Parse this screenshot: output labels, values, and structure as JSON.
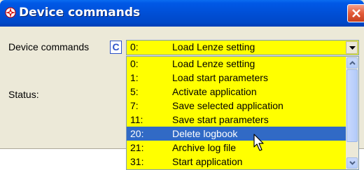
{
  "window": {
    "title": "Device commands",
    "close_icon": "close-x-icon",
    "app_icon": "compass-icon"
  },
  "form": {
    "device_commands_label": "Device commands",
    "badge": "C",
    "status_label": "Status:"
  },
  "combo": {
    "selected_num": "0:",
    "selected_text": "Load Lenze setting",
    "arrow_icon": "chevron-down-icon"
  },
  "dropdown": {
    "items": [
      {
        "num": "0:",
        "text": "Load Lenze setting"
      },
      {
        "num": "1:",
        "text": "Load start parameters"
      },
      {
        "num": "5:",
        "text": "Activate application"
      },
      {
        "num": "7:",
        "text": "Save selected application"
      },
      {
        "num": "11:",
        "text": "Save start parameters"
      },
      {
        "num": "20:",
        "text": "Delete logbook"
      },
      {
        "num": "21:",
        "text": "Archive log file"
      },
      {
        "num": "31:",
        "text": "Start application"
      }
    ],
    "selected_index": 5
  },
  "colors": {
    "list_background": "#ffff00",
    "highlight": "#316ac5",
    "titlebar": "#0050d8"
  }
}
